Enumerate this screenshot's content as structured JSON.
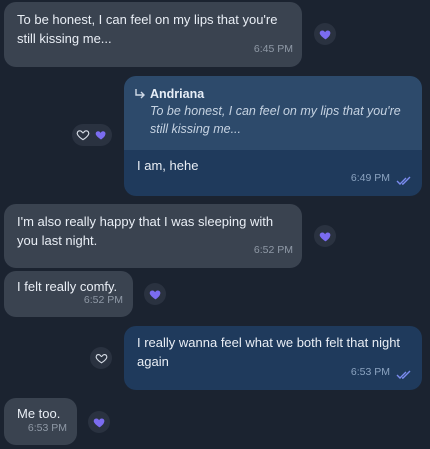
{
  "messages": [
    {
      "text": "To be honest, I can feel on my lips that you're\nstill kissing me...",
      "time": "6:45 PM"
    },
    {
      "reply_author": "Andriana",
      "reply_text": "To be honest, I can feel on my lips that you're\nstill kissing me...",
      "text": "I am, hehe",
      "time": "6:49 PM"
    },
    {
      "text": "I'm also really happy that I was sleeping with\nyou last night.",
      "time": "6:52 PM"
    },
    {
      "text": "I felt really comfy.",
      "time": "6:52 PM"
    },
    {
      "text": "I really wanna feel what we both felt that night\nagain",
      "time": "6:53 PM"
    },
    {
      "text": "Me too.",
      "time": "6:53 PM"
    }
  ],
  "colors": {
    "background": "#1b2330",
    "incoming_bubble": "#3a4350",
    "outgoing_bubble": "#1f3a5c",
    "reaction_heart": "#7b6cf0",
    "read_checks": "#7b8cf0"
  },
  "icons": {
    "reaction": "purple-heart-icon",
    "reaction_add": "heart-outline-icon",
    "reply": "reply-arrow-icon",
    "read": "double-check-icon"
  }
}
